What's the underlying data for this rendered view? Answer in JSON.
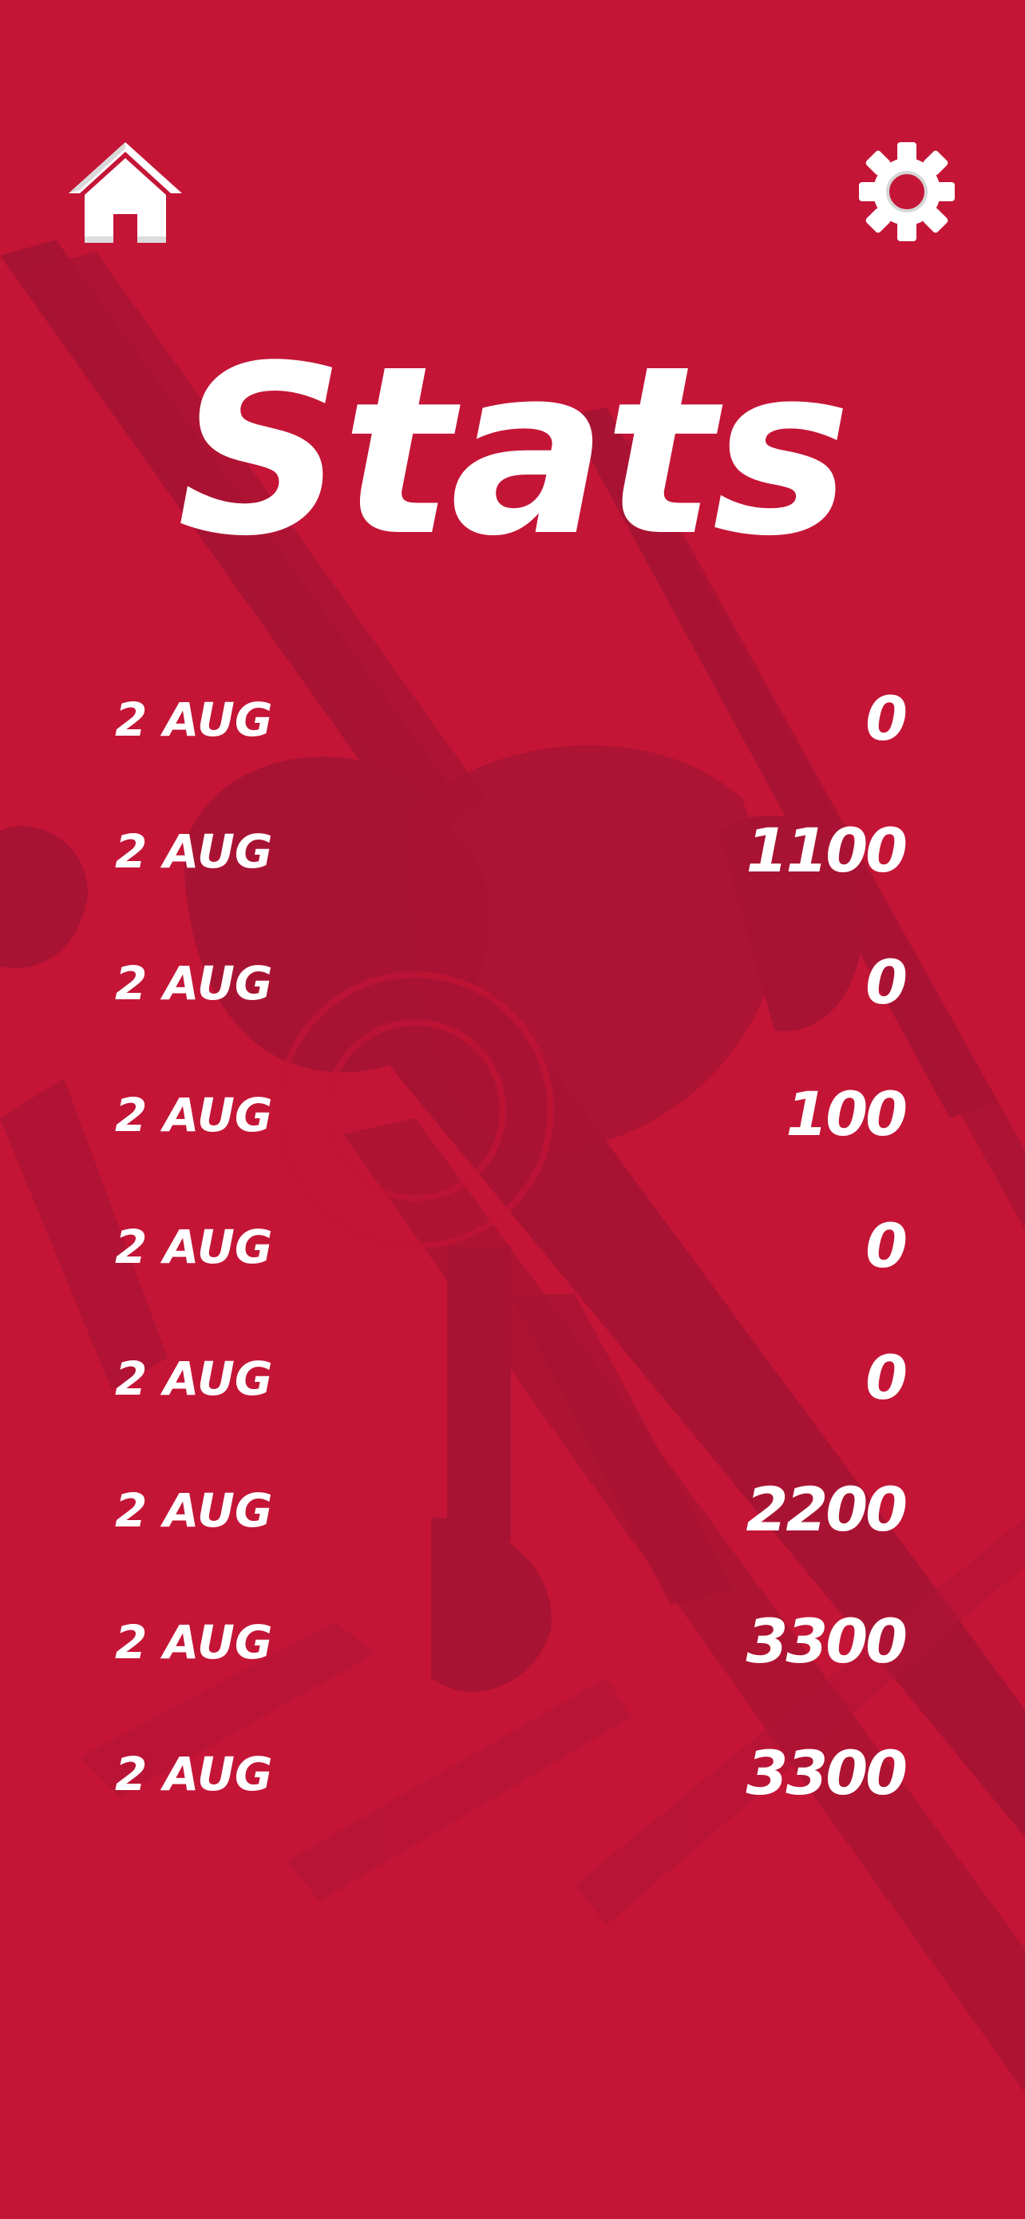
{
  "screen": {
    "title": "Stats",
    "background_color": "#c41537",
    "text_color": "#ffffff"
  },
  "icons": {
    "home": "home-icon",
    "settings": "gear-icon"
  },
  "stats": [
    {
      "date": "2 AUG",
      "score": "0"
    },
    {
      "date": "2 AUG",
      "score": "1100"
    },
    {
      "date": "2 AUG",
      "score": "0"
    },
    {
      "date": "2 AUG",
      "score": "100"
    },
    {
      "date": "2 AUG",
      "score": "0"
    },
    {
      "date": "2 AUG",
      "score": "0"
    },
    {
      "date": "2 AUG",
      "score": "2200"
    },
    {
      "date": "2 AUG",
      "score": "3300"
    },
    {
      "date": "2 AUG",
      "score": "3300"
    }
  ]
}
